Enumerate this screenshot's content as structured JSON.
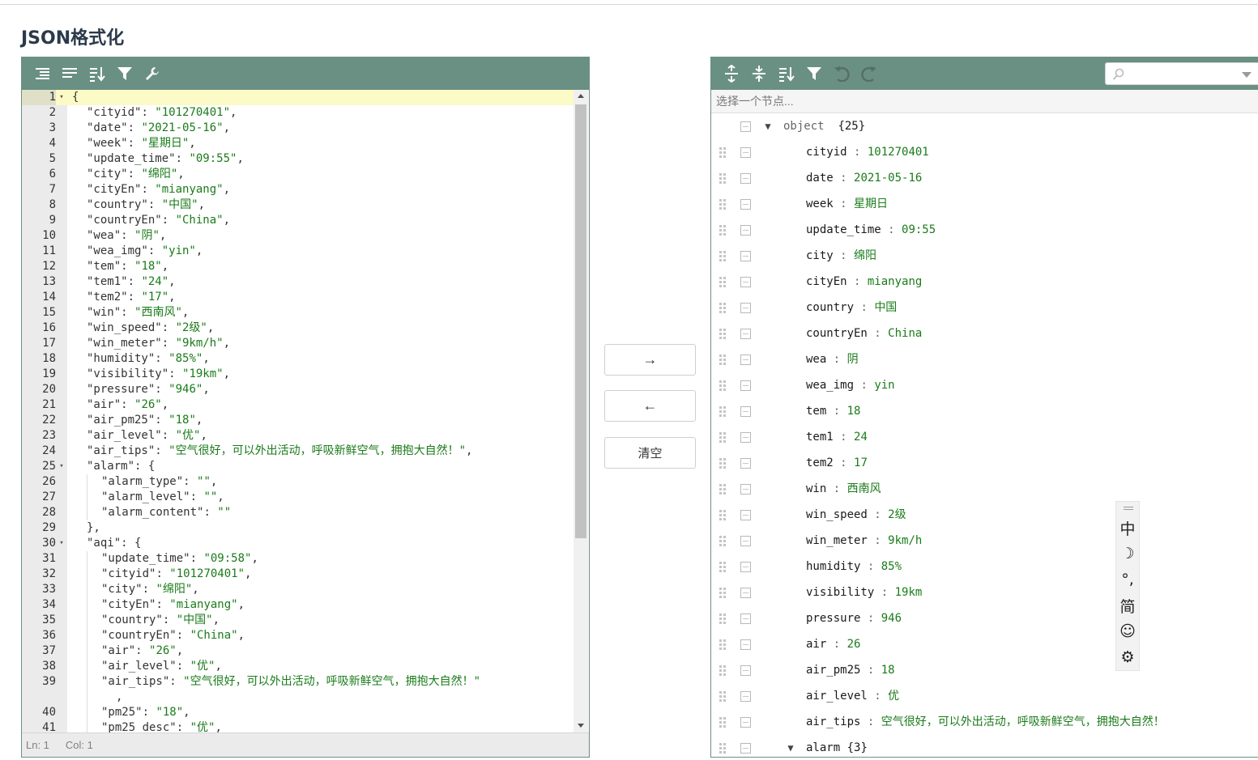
{
  "page": {
    "title": "JSON格式化"
  },
  "left_editor": {
    "toolbar": [
      {
        "name": "format-icon",
        "title": "格式化"
      },
      {
        "name": "compact-icon",
        "title": "压缩"
      },
      {
        "name": "sort-icon",
        "title": "排序"
      },
      {
        "name": "filter-icon",
        "title": "过滤"
      },
      {
        "name": "repair-icon",
        "title": "修复"
      }
    ],
    "lines": [
      {
        "n": "1",
        "fold": "▾",
        "indent": 0,
        "active": true,
        "parts": [
          [
            "p",
            "{"
          ]
        ]
      },
      {
        "n": "2",
        "indent": 1,
        "parts": [
          [
            "k",
            "\"cityid\""
          ],
          [
            "p",
            ": "
          ],
          [
            "s",
            "\"101270401\""
          ],
          [
            "p",
            ","
          ]
        ]
      },
      {
        "n": "3",
        "indent": 1,
        "parts": [
          [
            "k",
            "\"date\""
          ],
          [
            "p",
            ": "
          ],
          [
            "s",
            "\"2021-05-16\""
          ],
          [
            "p",
            ","
          ]
        ]
      },
      {
        "n": "4",
        "indent": 1,
        "parts": [
          [
            "k",
            "\"week\""
          ],
          [
            "p",
            ": "
          ],
          [
            "s",
            "\"星期日\""
          ],
          [
            "p",
            ","
          ]
        ]
      },
      {
        "n": "5",
        "indent": 1,
        "parts": [
          [
            "k",
            "\"update_time\""
          ],
          [
            "p",
            ": "
          ],
          [
            "s",
            "\"09:55\""
          ],
          [
            "p",
            ","
          ]
        ]
      },
      {
        "n": "6",
        "indent": 1,
        "parts": [
          [
            "k",
            "\"city\""
          ],
          [
            "p",
            ": "
          ],
          [
            "s",
            "\"绵阳\""
          ],
          [
            "p",
            ","
          ]
        ]
      },
      {
        "n": "7",
        "indent": 1,
        "parts": [
          [
            "k",
            "\"cityEn\""
          ],
          [
            "p",
            ": "
          ],
          [
            "s",
            "\"mianyang\""
          ],
          [
            "p",
            ","
          ]
        ]
      },
      {
        "n": "8",
        "indent": 1,
        "parts": [
          [
            "k",
            "\"country\""
          ],
          [
            "p",
            ": "
          ],
          [
            "s",
            "\"中国\""
          ],
          [
            "p",
            ","
          ]
        ]
      },
      {
        "n": "9",
        "indent": 1,
        "parts": [
          [
            "k",
            "\"countryEn\""
          ],
          [
            "p",
            ": "
          ],
          [
            "s",
            "\"China\""
          ],
          [
            "p",
            ","
          ]
        ]
      },
      {
        "n": "10",
        "indent": 1,
        "parts": [
          [
            "k",
            "\"wea\""
          ],
          [
            "p",
            ": "
          ],
          [
            "s",
            "\"阴\""
          ],
          [
            "p",
            ","
          ]
        ]
      },
      {
        "n": "11",
        "indent": 1,
        "parts": [
          [
            "k",
            "\"wea_img\""
          ],
          [
            "p",
            ": "
          ],
          [
            "s",
            "\"yin\""
          ],
          [
            "p",
            ","
          ]
        ]
      },
      {
        "n": "12",
        "indent": 1,
        "parts": [
          [
            "k",
            "\"tem\""
          ],
          [
            "p",
            ": "
          ],
          [
            "s",
            "\"18\""
          ],
          [
            "p",
            ","
          ]
        ]
      },
      {
        "n": "13",
        "indent": 1,
        "parts": [
          [
            "k",
            "\"tem1\""
          ],
          [
            "p",
            ": "
          ],
          [
            "s",
            "\"24\""
          ],
          [
            "p",
            ","
          ]
        ]
      },
      {
        "n": "14",
        "indent": 1,
        "parts": [
          [
            "k",
            "\"tem2\""
          ],
          [
            "p",
            ": "
          ],
          [
            "s",
            "\"17\""
          ],
          [
            "p",
            ","
          ]
        ]
      },
      {
        "n": "15",
        "indent": 1,
        "parts": [
          [
            "k",
            "\"win\""
          ],
          [
            "p",
            ": "
          ],
          [
            "s",
            "\"西南风\""
          ],
          [
            "p",
            ","
          ]
        ]
      },
      {
        "n": "16",
        "indent": 1,
        "parts": [
          [
            "k",
            "\"win_speed\""
          ],
          [
            "p",
            ": "
          ],
          [
            "s",
            "\"2级\""
          ],
          [
            "p",
            ","
          ]
        ]
      },
      {
        "n": "17",
        "indent": 1,
        "parts": [
          [
            "k",
            "\"win_meter\""
          ],
          [
            "p",
            ": "
          ],
          [
            "s",
            "\"9km/h\""
          ],
          [
            "p",
            ","
          ]
        ]
      },
      {
        "n": "18",
        "indent": 1,
        "parts": [
          [
            "k",
            "\"humidity\""
          ],
          [
            "p",
            ": "
          ],
          [
            "s",
            "\"85%\""
          ],
          [
            "p",
            ","
          ]
        ]
      },
      {
        "n": "19",
        "indent": 1,
        "parts": [
          [
            "k",
            "\"visibility\""
          ],
          [
            "p",
            ": "
          ],
          [
            "s",
            "\"19km\""
          ],
          [
            "p",
            ","
          ]
        ]
      },
      {
        "n": "20",
        "indent": 1,
        "parts": [
          [
            "k",
            "\"pressure\""
          ],
          [
            "p",
            ": "
          ],
          [
            "s",
            "\"946\""
          ],
          [
            "p",
            ","
          ]
        ]
      },
      {
        "n": "21",
        "indent": 1,
        "parts": [
          [
            "k",
            "\"air\""
          ],
          [
            "p",
            ": "
          ],
          [
            "s",
            "\"26\""
          ],
          [
            "p",
            ","
          ]
        ]
      },
      {
        "n": "22",
        "indent": 1,
        "parts": [
          [
            "k",
            "\"air_pm25\""
          ],
          [
            "p",
            ": "
          ],
          [
            "s",
            "\"18\""
          ],
          [
            "p",
            ","
          ]
        ]
      },
      {
        "n": "23",
        "indent": 1,
        "parts": [
          [
            "k",
            "\"air_level\""
          ],
          [
            "p",
            ": "
          ],
          [
            "s",
            "\"优\""
          ],
          [
            "p",
            ","
          ]
        ]
      },
      {
        "n": "24",
        "indent": 1,
        "parts": [
          [
            "k",
            "\"air_tips\""
          ],
          [
            "p",
            ": "
          ],
          [
            "s",
            "\"空气很好，可以外出活动，呼吸新鲜空气，拥抱大自然！\""
          ],
          [
            "p",
            ","
          ]
        ]
      },
      {
        "n": "25",
        "fold": "▾",
        "indent": 1,
        "parts": [
          [
            "k",
            "\"alarm\""
          ],
          [
            "p",
            ": {"
          ]
        ]
      },
      {
        "n": "26",
        "indent": 2,
        "parts": [
          [
            "k",
            "\"alarm_type\""
          ],
          [
            "p",
            ": "
          ],
          [
            "s",
            "\"\""
          ],
          [
            "p",
            ","
          ]
        ]
      },
      {
        "n": "27",
        "indent": 2,
        "parts": [
          [
            "k",
            "\"alarm_level\""
          ],
          [
            "p",
            ": "
          ],
          [
            "s",
            "\"\""
          ],
          [
            "p",
            ","
          ]
        ]
      },
      {
        "n": "28",
        "indent": 2,
        "parts": [
          [
            "k",
            "\"alarm_content\""
          ],
          [
            "p",
            ": "
          ],
          [
            "s",
            "\"\""
          ]
        ]
      },
      {
        "n": "29",
        "indent": 1,
        "parts": [
          [
            "p",
            "},"
          ]
        ]
      },
      {
        "n": "30",
        "fold": "▾",
        "indent": 1,
        "parts": [
          [
            "k",
            "\"aqi\""
          ],
          [
            "p",
            ": {"
          ]
        ]
      },
      {
        "n": "31",
        "indent": 2,
        "parts": [
          [
            "k",
            "\"update_time\""
          ],
          [
            "p",
            ": "
          ],
          [
            "s",
            "\"09:58\""
          ],
          [
            "p",
            ","
          ]
        ]
      },
      {
        "n": "32",
        "indent": 2,
        "parts": [
          [
            "k",
            "\"cityid\""
          ],
          [
            "p",
            ": "
          ],
          [
            "s",
            "\"101270401\""
          ],
          [
            "p",
            ","
          ]
        ]
      },
      {
        "n": "33",
        "indent": 2,
        "parts": [
          [
            "k",
            "\"city\""
          ],
          [
            "p",
            ": "
          ],
          [
            "s",
            "\"绵阳\""
          ],
          [
            "p",
            ","
          ]
        ]
      },
      {
        "n": "34",
        "indent": 2,
        "parts": [
          [
            "k",
            "\"cityEn\""
          ],
          [
            "p",
            ": "
          ],
          [
            "s",
            "\"mianyang\""
          ],
          [
            "p",
            ","
          ]
        ]
      },
      {
        "n": "35",
        "indent": 2,
        "parts": [
          [
            "k",
            "\"country\""
          ],
          [
            "p",
            ": "
          ],
          [
            "s",
            "\"中国\""
          ],
          [
            "p",
            ","
          ]
        ]
      },
      {
        "n": "36",
        "indent": 2,
        "parts": [
          [
            "k",
            "\"countryEn\""
          ],
          [
            "p",
            ": "
          ],
          [
            "s",
            "\"China\""
          ],
          [
            "p",
            ","
          ]
        ]
      },
      {
        "n": "37",
        "indent": 2,
        "parts": [
          [
            "k",
            "\"air\""
          ],
          [
            "p",
            ": "
          ],
          [
            "s",
            "\"26\""
          ],
          [
            "p",
            ","
          ]
        ]
      },
      {
        "n": "38",
        "indent": 2,
        "parts": [
          [
            "k",
            "\"air_level\""
          ],
          [
            "p",
            ": "
          ],
          [
            "s",
            "\"优\""
          ],
          [
            "p",
            ","
          ]
        ]
      },
      {
        "n": "39",
        "indent": 2,
        "parts": [
          [
            "k",
            "\"air_tips\""
          ],
          [
            "p",
            ": "
          ],
          [
            "s",
            "\"空气很好，可以外出活动，呼吸新鲜空气，拥抱大自然！\""
          ]
        ]
      },
      {
        "n": "",
        "indent": 2,
        "wrap": true,
        "parts": [
          [
            "p",
            ","
          ]
        ]
      },
      {
        "n": "40",
        "indent": 2,
        "parts": [
          [
            "k",
            "\"pm25\""
          ],
          [
            "p",
            ": "
          ],
          [
            "s",
            "\"18\""
          ],
          [
            "p",
            ","
          ]
        ]
      },
      {
        "n": "41",
        "indent": 2,
        "parts": [
          [
            "k",
            "\"pm25_desc\""
          ],
          [
            "p",
            ": "
          ],
          [
            "s",
            "\"优\""
          ],
          [
            "p",
            ","
          ]
        ]
      }
    ],
    "status": {
      "ln": "Ln: 1",
      "col": "Col: 1"
    }
  },
  "middle": {
    "to_right": "→",
    "to_left": "←",
    "clear_label": "清空"
  },
  "right_tree": {
    "toolbar": [
      {
        "name": "expand-all-icon",
        "title": "展开全部"
      },
      {
        "name": "collapse-all-icon",
        "title": "折叠全部"
      },
      {
        "name": "sort-icon",
        "title": "排序"
      },
      {
        "name": "filter-icon",
        "title": "过滤"
      },
      {
        "name": "undo-icon",
        "title": "撤销",
        "disabled": true
      },
      {
        "name": "redo-icon",
        "title": "重做",
        "disabled": true
      }
    ],
    "search": {
      "placeholder": "",
      "value": ""
    },
    "nav_placeholder": "选择一个节点...",
    "root": {
      "label": "object",
      "count": "{25}"
    },
    "rows": [
      {
        "key": "cityid",
        "value": "101270401"
      },
      {
        "key": "date",
        "value": "2021-05-16"
      },
      {
        "key": "week",
        "value": "星期日"
      },
      {
        "key": "update_time",
        "value": "09:55"
      },
      {
        "key": "city",
        "value": "绵阳"
      },
      {
        "key": "cityEn",
        "value": "mianyang"
      },
      {
        "key": "country",
        "value": "中国"
      },
      {
        "key": "countryEn",
        "value": "China"
      },
      {
        "key": "wea",
        "value": "阴"
      },
      {
        "key": "wea_img",
        "value": "yin"
      },
      {
        "key": "tem",
        "value": "18"
      },
      {
        "key": "tem1",
        "value": "24"
      },
      {
        "key": "tem2",
        "value": "17"
      },
      {
        "key": "win",
        "value": "西南风"
      },
      {
        "key": "win_speed",
        "value": "2级"
      },
      {
        "key": "win_meter",
        "value": "9km/h"
      },
      {
        "key": "humidity",
        "value": "85%"
      },
      {
        "key": "visibility",
        "value": "19km"
      },
      {
        "key": "pressure",
        "value": "946"
      },
      {
        "key": "air",
        "value": "26"
      },
      {
        "key": "air_pm25",
        "value": "18"
      },
      {
        "key": "air_level",
        "value": "优"
      },
      {
        "key": "air_tips",
        "value": "空气很好，可以外出活动，呼吸新鲜空气，拥抱大自然！"
      },
      {
        "key": "alarm",
        "object": true,
        "count": "{3}"
      }
    ]
  },
  "ime_bar": {
    "items": [
      {
        "name": "ime-mode-icon",
        "glyph": "中"
      },
      {
        "name": "moon-icon",
        "glyph": "☽"
      },
      {
        "name": "punctuation-icon",
        "glyph": "°,"
      },
      {
        "name": "simplified-icon",
        "glyph": "简"
      },
      {
        "name": "emoji-icon",
        "glyph": "☺"
      },
      {
        "name": "settings-gear-icon",
        "glyph": "⚙"
      }
    ]
  }
}
